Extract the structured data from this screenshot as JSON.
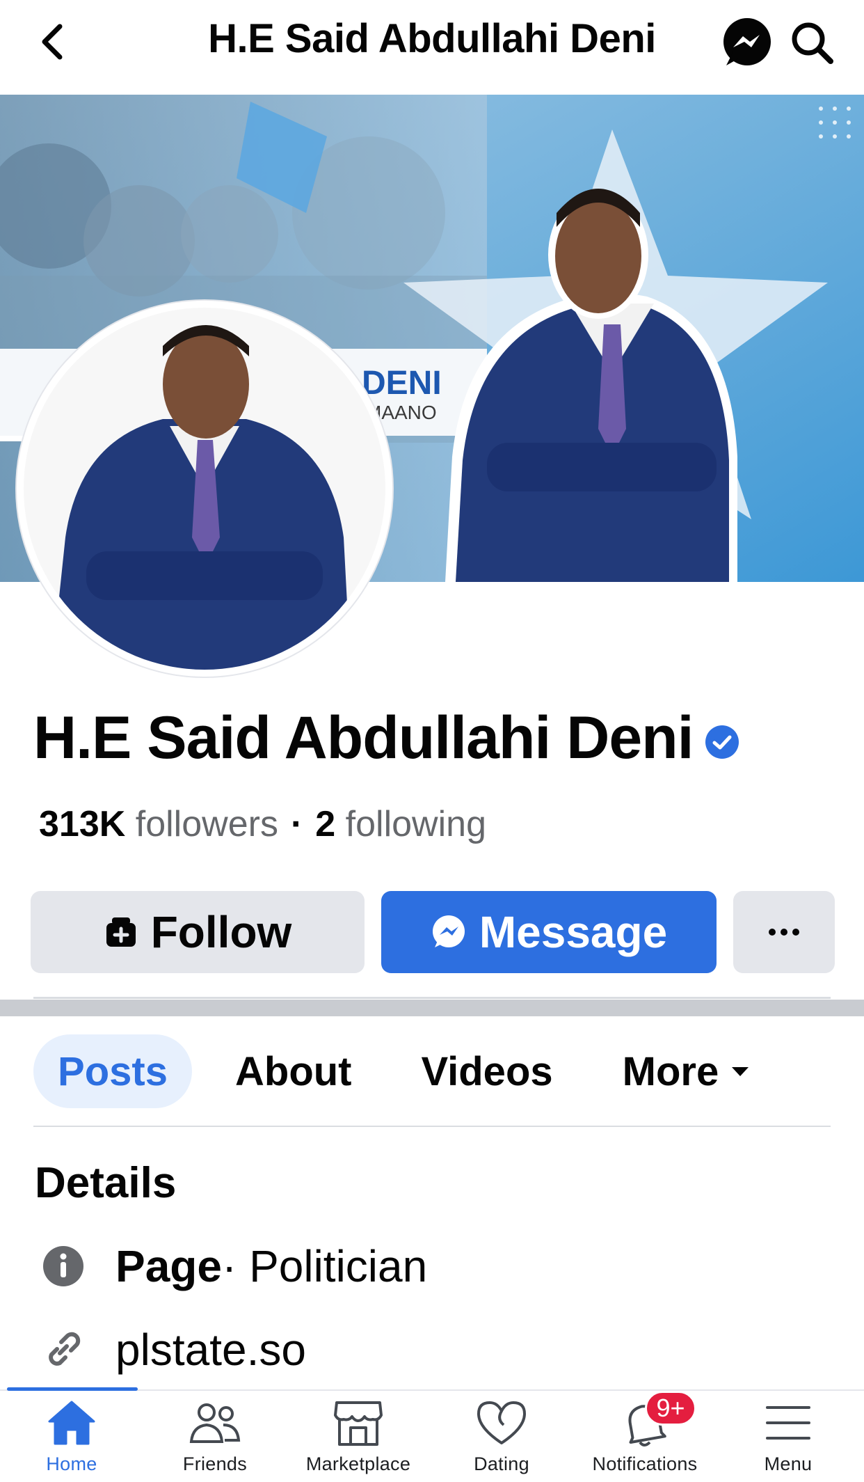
{
  "header": {
    "title": "H.E Said Abdullahi Deni"
  },
  "cover": {
    "banner_text": "DENI",
    "banner_subtext": "MAANO"
  },
  "profile": {
    "name": "H.E Said Abdullahi Deni",
    "verified": true,
    "followers_count": "313K",
    "followers_label": "followers",
    "separator": "·",
    "following_count": "2",
    "following_label": "following"
  },
  "actions": {
    "follow_label": "Follow",
    "message_label": "Message"
  },
  "tabs": [
    {
      "label": "Posts",
      "active": true
    },
    {
      "label": "About",
      "active": false
    },
    {
      "label": "Videos",
      "active": false
    },
    {
      "label": "More",
      "active": false
    }
  ],
  "details": {
    "title": "Details",
    "category_bold": "Page",
    "category_rest": " · Politician",
    "website": "plstate.so"
  },
  "bottom_nav": {
    "items": [
      {
        "label": "Home",
        "icon": "home-icon",
        "active": true
      },
      {
        "label": "Friends",
        "icon": "friends-icon",
        "active": false
      },
      {
        "label": "Marketplace",
        "icon": "marketplace-icon",
        "active": false
      },
      {
        "label": "Dating",
        "icon": "heart-icon",
        "active": false
      },
      {
        "label": "Notifications",
        "icon": "bell-icon",
        "active": false
      },
      {
        "label": "Menu",
        "icon": "menu-icon",
        "active": false
      }
    ],
    "notifications_badge": "9+"
  },
  "colors": {
    "accent": "#2d6fe0",
    "button_gray": "#e4e6eb",
    "badge_red": "#e41e3f",
    "secondary_text": "#65676b"
  }
}
